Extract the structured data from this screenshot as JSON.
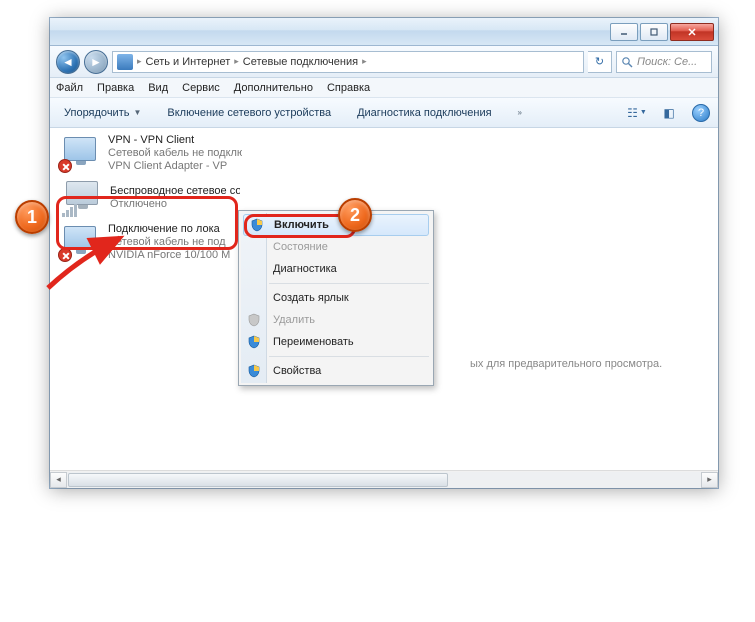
{
  "window": {
    "breadcrumb": {
      "level1": "Сеть и Интернет",
      "level2": "Сетевые подключения"
    },
    "search_placeholder": "Поиск: Се..."
  },
  "menubar": {
    "file": "Файл",
    "edit": "Правка",
    "view": "Вид",
    "service": "Сервис",
    "extra": "Дополнительно",
    "help": "Справка"
  },
  "cmdbar": {
    "organize": "Упорядочить",
    "enable_device": "Включение сетевого устройства",
    "diagnose": "Диагностика подключения"
  },
  "connections": [
    {
      "title": "VPN - VPN Client",
      "status": "Сетевой кабель не подключ",
      "device": "VPN Client Adapter - VP",
      "icon": "wired-x"
    },
    {
      "title": "Беспроводное сетевое соединение",
      "status": "Отключено",
      "device": "",
      "icon": "wireless"
    },
    {
      "title": "Подключение по лока",
      "status": "Сетевой кабель не под",
      "device": "NVIDIA nForce 10/100 M",
      "icon": "wired-x"
    }
  ],
  "context_menu": {
    "enable": "Включить",
    "state": "Состояние",
    "diagnostics": "Диагностика",
    "create_shortcut": "Создать ярлык",
    "delete": "Удалить",
    "rename": "Переименовать",
    "properties": "Свойства"
  },
  "preview_hint": "ых для предварительного просмотра.",
  "markers": {
    "one": "1",
    "two": "2"
  }
}
